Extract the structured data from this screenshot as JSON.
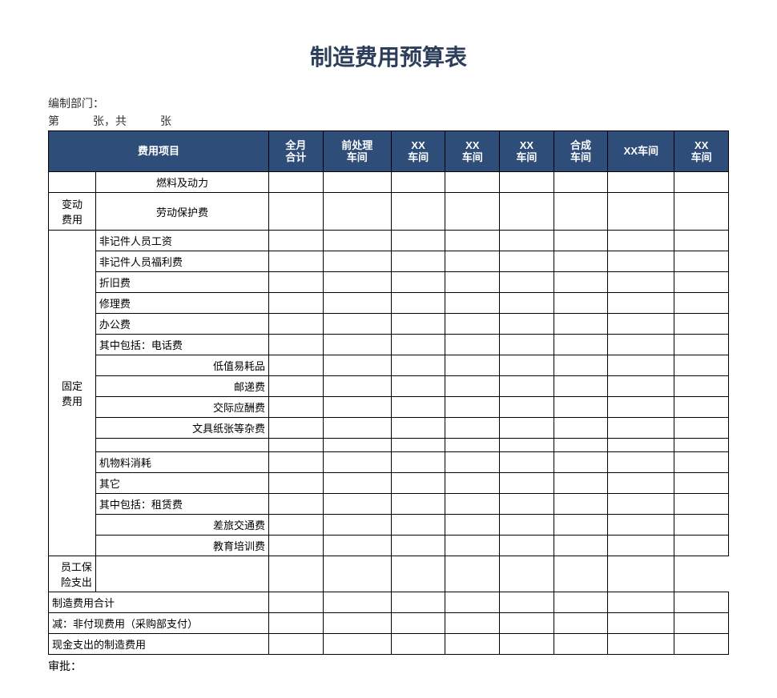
{
  "title": "制造费用预算表",
  "meta": {
    "dept_label": "编制部门：",
    "page_label": "第　　　张，共　　　张"
  },
  "header": {
    "item_col": "费用项目",
    "cols": [
      "全月\n合计",
      "前处理\n车间",
      "XX\n车间",
      "XX\n车间",
      "XX\n车间",
      "合成\n车间",
      "XX车间",
      "XX\n车间"
    ]
  },
  "rows": [
    {
      "cat": "",
      "item": "燃料及动力",
      "align": "center"
    },
    {
      "cat": "变动\n费用",
      "catspan": 1,
      "item": "劳动保护费",
      "align": "center",
      "tall": true
    },
    {
      "cat": "固定\n费用",
      "catspan": 16,
      "item": "非记件人员工资",
      "align": "left"
    },
    {
      "item": "非记件人员福利费",
      "align": "left"
    },
    {
      "item": "折旧费",
      "align": "left"
    },
    {
      "item": "修理费",
      "align": "left"
    },
    {
      "item": "办公费",
      "align": "left"
    },
    {
      "item": "其中包括：电话费",
      "align": "left"
    },
    {
      "item": "低值易耗品",
      "align": "right"
    },
    {
      "item": "邮递费",
      "align": "right"
    },
    {
      "item": "交际应酬费",
      "align": "right"
    },
    {
      "item": "文具纸张等杂费",
      "align": "right"
    },
    {
      "item": "",
      "spacer": true
    },
    {
      "item": "机物料消耗",
      "align": "left"
    },
    {
      "item": "其它",
      "align": "left"
    },
    {
      "item": "其中包括：租赁费",
      "align": "left"
    },
    {
      "item": "差旅交通费",
      "align": "right"
    },
    {
      "item": "教育培训费",
      "align": "right"
    },
    {
      "item": "员工保险支出",
      "align": "right"
    },
    {
      "full": true,
      "item": "制造费用合计",
      "align": "left"
    },
    {
      "full": true,
      "item": "减：非付现费用（采购部支付）",
      "align": "left"
    },
    {
      "full": true,
      "item": "现金支出的制造费用",
      "align": "left"
    }
  ],
  "footer": {
    "approve_label": "审批："
  },
  "chart_data": {
    "type": "table",
    "title": "制造费用预算表",
    "columns": [
      "费用项目",
      "全月合计",
      "前处理车间",
      "XX车间",
      "XX车间",
      "XX车间",
      "合成车间",
      "XX车间",
      "XX车间"
    ],
    "row_groups": [
      {
        "category": "变动费用",
        "items": [
          "燃料及动力",
          "劳动保护费"
        ]
      },
      {
        "category": "固定费用",
        "items": [
          "非记件人员工资",
          "非记件人员福利费",
          "折旧费",
          "修理费",
          "办公费",
          "其中包括：电话费",
          "低值易耗品",
          "邮递费",
          "交际应酬费",
          "文具纸张等杂费",
          "机物料消耗",
          "其它",
          "其中包括：租赁费",
          "差旅交通费",
          "教育培训费",
          "员工保险支出"
        ]
      }
    ],
    "summary_rows": [
      "制造费用合计",
      "减：非付现费用（采购部支付）",
      "现金支出的制造费用"
    ],
    "footer": "审批："
  }
}
